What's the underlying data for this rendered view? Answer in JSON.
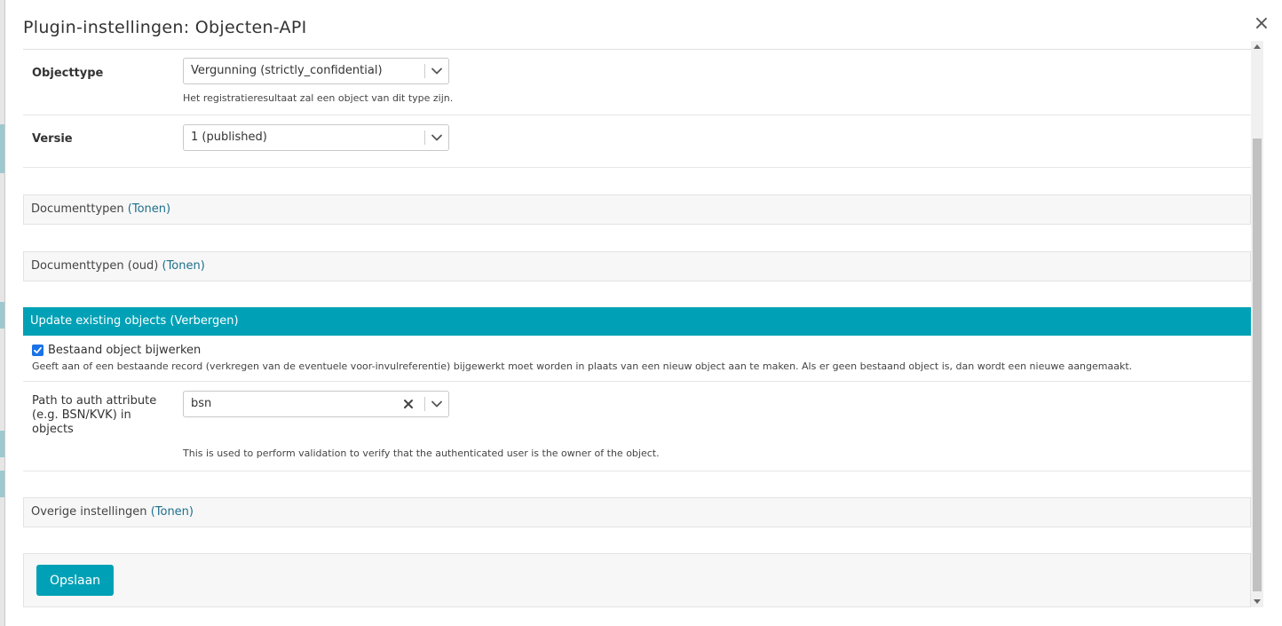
{
  "modal": {
    "title": "Plugin-instellingen: Objecten-API",
    "close_symbol": "×"
  },
  "objecttype": {
    "label": "Objecttype",
    "selected": "Vergunning (strictly_confidential)",
    "help": "Het registratieresultaat zal een object van dit type zijn."
  },
  "versie": {
    "label": "Versie",
    "selected": "1 (published)"
  },
  "sections": {
    "documenttypen": {
      "label": "Documenttypen",
      "toggle": "(Tonen)"
    },
    "documenttypen_oud": {
      "label": "Documenttypen (oud)",
      "toggle": "(Tonen)"
    },
    "update_existing": {
      "label": "Update existing objects",
      "toggle": "(Verbergen)"
    },
    "overige": {
      "label": "Overige instellingen",
      "toggle": "(Tonen)"
    }
  },
  "update_existing": {
    "checkbox_label": "Bestaand object bijwerken",
    "checkbox_checked": true,
    "checkbox_help": "Geeft aan of een bestaande record (verkregen van de eventuele voor-invulreferentie) bijgewerkt moet worden in plaats van een nieuw object aan te maken. Als er geen bestaand object is, dan wordt een nieuwe aangemaakt.",
    "path_label": "Path to auth attribute (e.g. BSN/KVK) in objects",
    "path_value": "bsn",
    "path_help": "This is used to perform validation to verify that the authenticated user is the owner of the object."
  },
  "actions": {
    "save_label": "Opslaan"
  },
  "colors": {
    "accent": "#00a1b6",
    "link": "#1e6f8c",
    "checkbox": "#1a73e8"
  },
  "icons": {
    "close": "close-icon",
    "chevron": "chevron-down-icon",
    "clear": "clear-icon",
    "check": "check-icon"
  }
}
